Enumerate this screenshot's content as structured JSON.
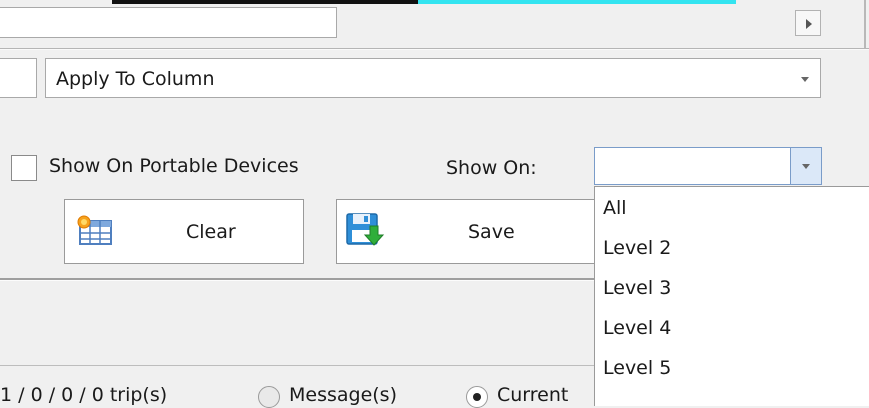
{
  "apply_to_column": {
    "value": "Apply To Column"
  },
  "portable_devices": {
    "label": "Show On Portable Devices",
    "checked": false
  },
  "show_on": {
    "label": "Show On:",
    "value": "",
    "options": [
      "All",
      "Level 2",
      "Level 3",
      "Level 4",
      "Level 5"
    ]
  },
  "buttons": {
    "clear_label": "Clear",
    "save_label": "Save"
  },
  "status": {
    "trips_text": "1 / 0 / 0 / 0 trip(s)",
    "message_label": "Message(s)",
    "current_label": "Current"
  },
  "icons": {
    "clear": "grid-sun-icon",
    "save": "floppy-disk-arrow-icon"
  },
  "colors": {
    "accent_cyan": "#33e4f0",
    "select_border": "#7a9cc9",
    "select_button": "#dbe8f8"
  }
}
